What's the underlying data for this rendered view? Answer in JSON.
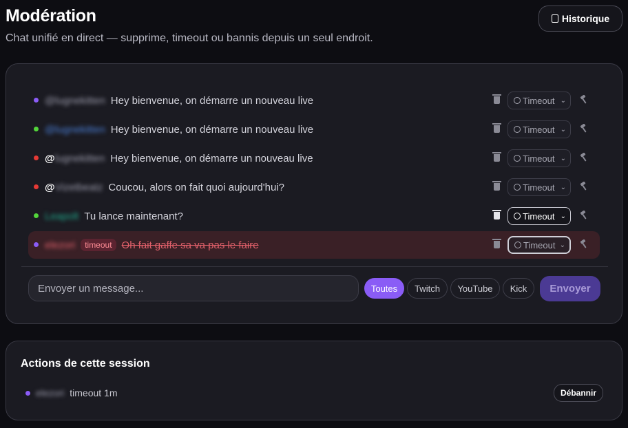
{
  "header": {
    "title": "Modération",
    "subtitle": "Chat unifié en direct — supprime, timeout ou bannis depuis un seul endroit.",
    "history_label": "Historique"
  },
  "chat": {
    "messages": [
      {
        "user": "@lugnekitten",
        "at": "",
        "text": "Hey bienvenue, on démarre un nouveau live",
        "platform_color": "#8b5cf6",
        "user_color": "#9a9aaa",
        "timeout_tag": "",
        "action_label": "Timeout"
      },
      {
        "user": "@lugnekitten",
        "at": "",
        "text": "Hey bienvenue, on démarre un nouveau live",
        "platform_color": "#53d53b",
        "user_color": "#4a7fd8",
        "timeout_tag": "",
        "action_label": "Timeout"
      },
      {
        "user": "lugnekitten",
        "at": "@",
        "text": "Hey bienvenue, on démarre un nouveau live",
        "platform_color": "#e53935",
        "user_color": "#9a9aaa",
        "timeout_tag": "",
        "action_label": "Timeout"
      },
      {
        "user": "Vizetbeatz",
        "at": "@",
        "text": "Coucou, alors on fait quoi aujourd'hui?",
        "platform_color": "#e53935",
        "user_color": "#9a9aaa",
        "timeout_tag": "",
        "action_label": "Timeout"
      },
      {
        "user": "Leapolt",
        "at": "",
        "text": "Tu lance maintenant?",
        "platform_color": "#53d53b",
        "user_color": "#1fa88a",
        "timeout_tag": "",
        "action_label": "Timeout"
      },
      {
        "user": "elezori",
        "at": "",
        "text": "Oh fait gaffe sa va pas le faire",
        "platform_color": "#8b5cf6",
        "user_color": "#e0606a",
        "timeout_tag": "timeout",
        "action_label": "Timeout"
      }
    ],
    "input_placeholder": "Envoyer un message...",
    "filters": [
      "Toutes",
      "Twitch",
      "YouTube",
      "Kick"
    ],
    "send_label": "Envoyer"
  },
  "session": {
    "title": "Actions de cette session",
    "actions": [
      {
        "user": "elezori",
        "text": "timeout 1m",
        "platform_color": "#8b5cf6",
        "button": "Débannir"
      }
    ]
  },
  "colors": {
    "accent": "#8a5cf6",
    "twitch": "#8b5cf6",
    "kick": "#53d53b",
    "youtube": "#e53935"
  }
}
